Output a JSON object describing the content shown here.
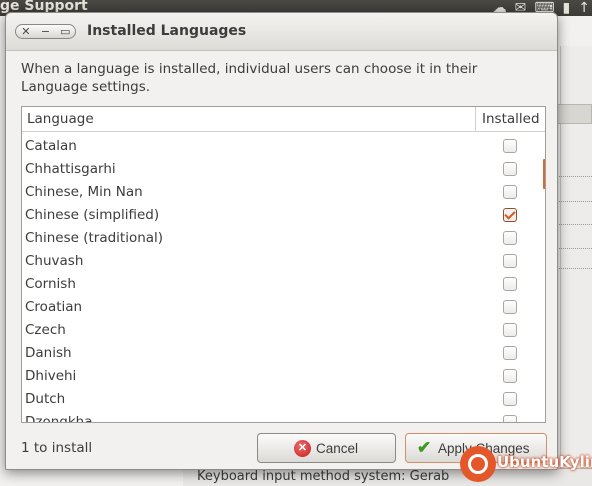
{
  "background": {
    "app_title": "ge Support",
    "bottom_text": "Keyboard input method system:   Gerab",
    "tray_icons": [
      "network-icon",
      "mail-icon",
      "keyboard-icon",
      "battery-icon",
      "clock-icon"
    ]
  },
  "dialog": {
    "title": "Installed Languages",
    "description": "When a language is installed, individual users can choose it in their Language settings.",
    "columns": {
      "language": "Language",
      "installed": "Installed"
    },
    "languages": [
      {
        "name": "Catalan",
        "installed": false
      },
      {
        "name": "Chhattisgarhi",
        "installed": false
      },
      {
        "name": "Chinese, Min Nan",
        "installed": false
      },
      {
        "name": "Chinese (simplified)",
        "installed": true
      },
      {
        "name": "Chinese (traditional)",
        "installed": false
      },
      {
        "name": "Chuvash",
        "installed": false
      },
      {
        "name": "Cornish",
        "installed": false
      },
      {
        "name": "Croatian",
        "installed": false
      },
      {
        "name": "Czech",
        "installed": false
      },
      {
        "name": "Danish",
        "installed": false
      },
      {
        "name": "Dhivehi",
        "installed": false
      },
      {
        "name": "Dutch",
        "installed": false
      },
      {
        "name": "Dzongkha",
        "installed": false
      }
    ],
    "status": "1 to install",
    "cancel_label": "Cancel",
    "apply_label": "Apply Changes",
    "accent_color": "#d35a21"
  },
  "watermark": {
    "text": "UbuntuKylin"
  }
}
